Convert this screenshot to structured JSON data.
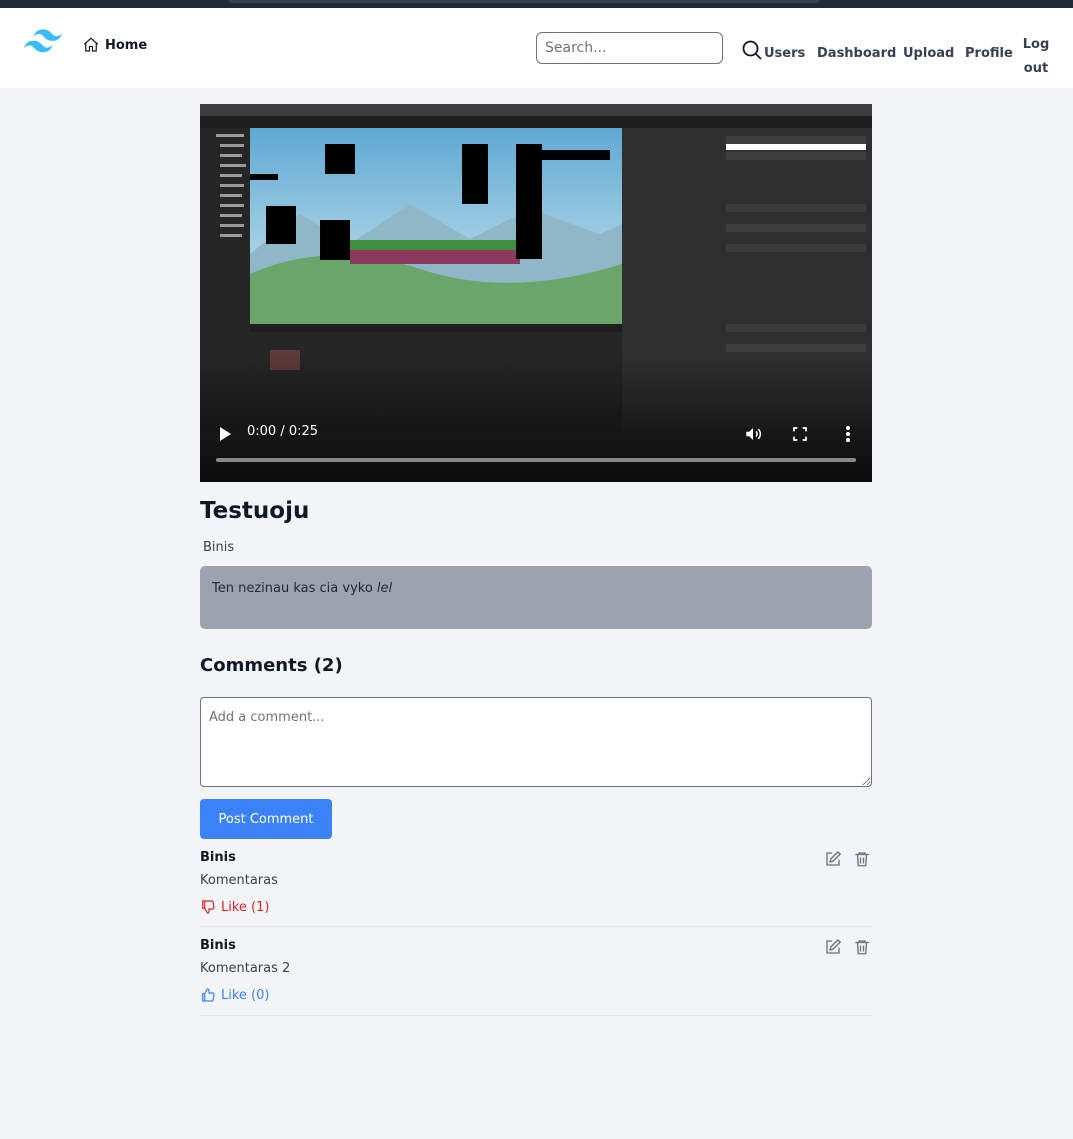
{
  "nav": {
    "home_label": "Home",
    "search_placeholder": "Search...",
    "links": [
      "Users",
      "Dashboard",
      "Upload",
      "Profile"
    ],
    "logout_line1": "Log",
    "logout_line2": "out"
  },
  "video": {
    "time": "0:00 / 0:25",
    "title": "Testuoju",
    "author": "Binis",
    "description_text": "Ten nezinau kas cia vyko ",
    "description_emphasis": "lel"
  },
  "comments": {
    "heading": "Comments (2)",
    "input_placeholder": "Add a comment...",
    "post_label": "Post Comment",
    "items": [
      {
        "author": "Binis",
        "text": "Komentaras",
        "like_label": "Like (1)",
        "liked": true
      },
      {
        "author": "Binis",
        "text": "Komentaras 2",
        "like_label": "Like (0)",
        "liked": false
      }
    ]
  },
  "colors": {
    "accent": "#3b82f6",
    "liked": "#dc2626",
    "description_bg": "#9ca3af",
    "logo": "#38bdf8"
  },
  "icons": {
    "logo": "tailwind-logo-icon",
    "home": "home-icon",
    "search": "search-icon",
    "play": "play-icon",
    "volume": "volume-icon",
    "fullscreen": "fullscreen-icon",
    "more": "more-vertical-icon",
    "like_down": "thumb-down-icon",
    "like_up": "thumb-up-icon",
    "edit": "edit-icon",
    "delete": "trash-icon"
  }
}
